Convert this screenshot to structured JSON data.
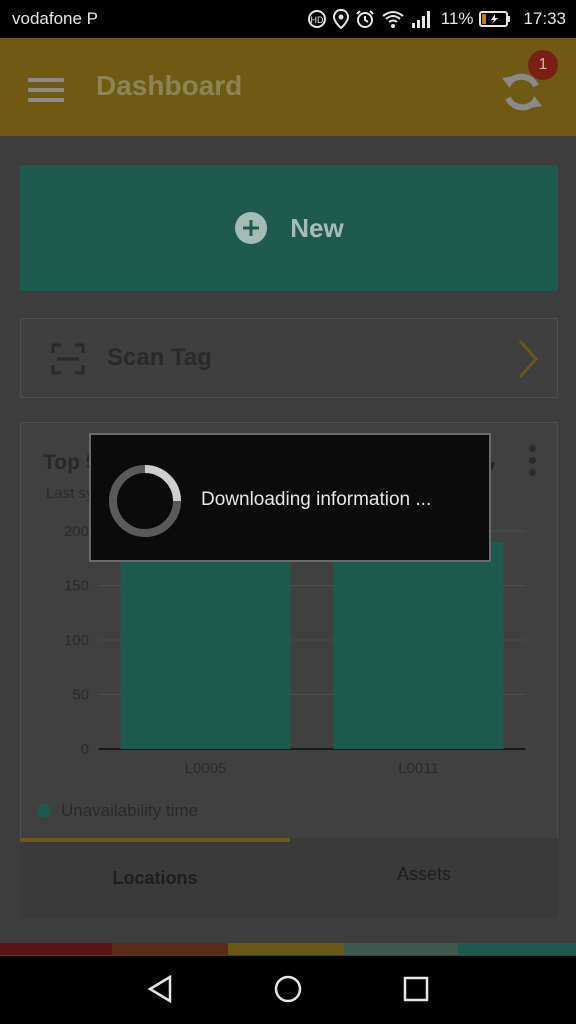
{
  "status_bar": {
    "carrier": "vodafone P",
    "battery": "11%",
    "time": "17:33",
    "icons": [
      "volte-icon",
      "location-icon",
      "alarm-icon",
      "wifi-icon",
      "signal-icon",
      "battery-charging-icon"
    ]
  },
  "app_bar": {
    "title": "Dashboard",
    "sync_badge": "1"
  },
  "new_button": {
    "label": "New"
  },
  "scan_card": {
    "label": "Scan Tag"
  },
  "chart_card": {
    "title": "Top 5 locations unavailability",
    "subtitle": "Last synced 20"
  },
  "chart_data": {
    "type": "bar",
    "categories": [
      "L0005",
      "L0011"
    ],
    "values": [
      190,
      190
    ],
    "ylim": [
      0,
      200
    ],
    "yticks": [
      0,
      50,
      100,
      150,
      200
    ],
    "legend": [
      "Unavailability time"
    ],
    "series_color": "#1f5a4e",
    "grid": true
  },
  "tabs": [
    {
      "label": "Locations",
      "active": true
    },
    {
      "label": "Assets",
      "active": false
    }
  ],
  "dialog": {
    "message": "Downloading information ..."
  },
  "colors": {
    "primary": "#6f5a14",
    "accent_green": "#1f5a4e",
    "stripe": [
      "#5a1412",
      "#5c2c16",
      "#6b5714",
      "#3c5a4e",
      "#1f5a4e"
    ]
  }
}
